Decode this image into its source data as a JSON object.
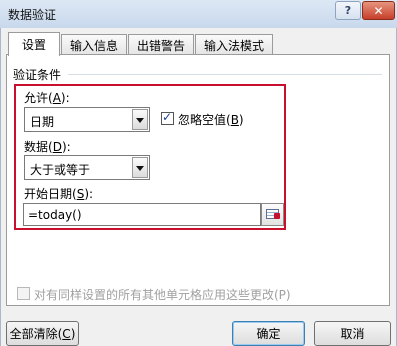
{
  "window": {
    "title": "数据验证",
    "help": "?",
    "close": "✕"
  },
  "tabs": [
    "设置",
    "输入信息",
    "出错警告",
    "输入法模式"
  ],
  "group": {
    "title": "验证条件"
  },
  "allow": {
    "label_pre": "允许(",
    "label_key": "A",
    "label_post": "):",
    "value": "日期"
  },
  "ignore_blank": {
    "label_pre": "忽略空值(",
    "label_key": "B",
    "label_post": ")",
    "checked": true
  },
  "data": {
    "label_pre": "数据(",
    "label_key": "D",
    "label_post": "):",
    "value": "大于或等于"
  },
  "start_date": {
    "label_pre": "开始日期(",
    "label_key": "S",
    "label_post": "):",
    "value": "=today()"
  },
  "apply_all": {
    "label": "对有同样设置的所有其他单元格应用这些更改(P)",
    "checked": false
  },
  "buttons": {
    "clear_all_pre": "全部清除(",
    "clear_all_key": "C",
    "clear_all_post": ")",
    "ok": "确定",
    "cancel": "取消"
  },
  "icons": {
    "help": "question-icon",
    "close": "close-icon",
    "dropdown": "chevron-down-icon",
    "ref": "range-select-icon"
  }
}
